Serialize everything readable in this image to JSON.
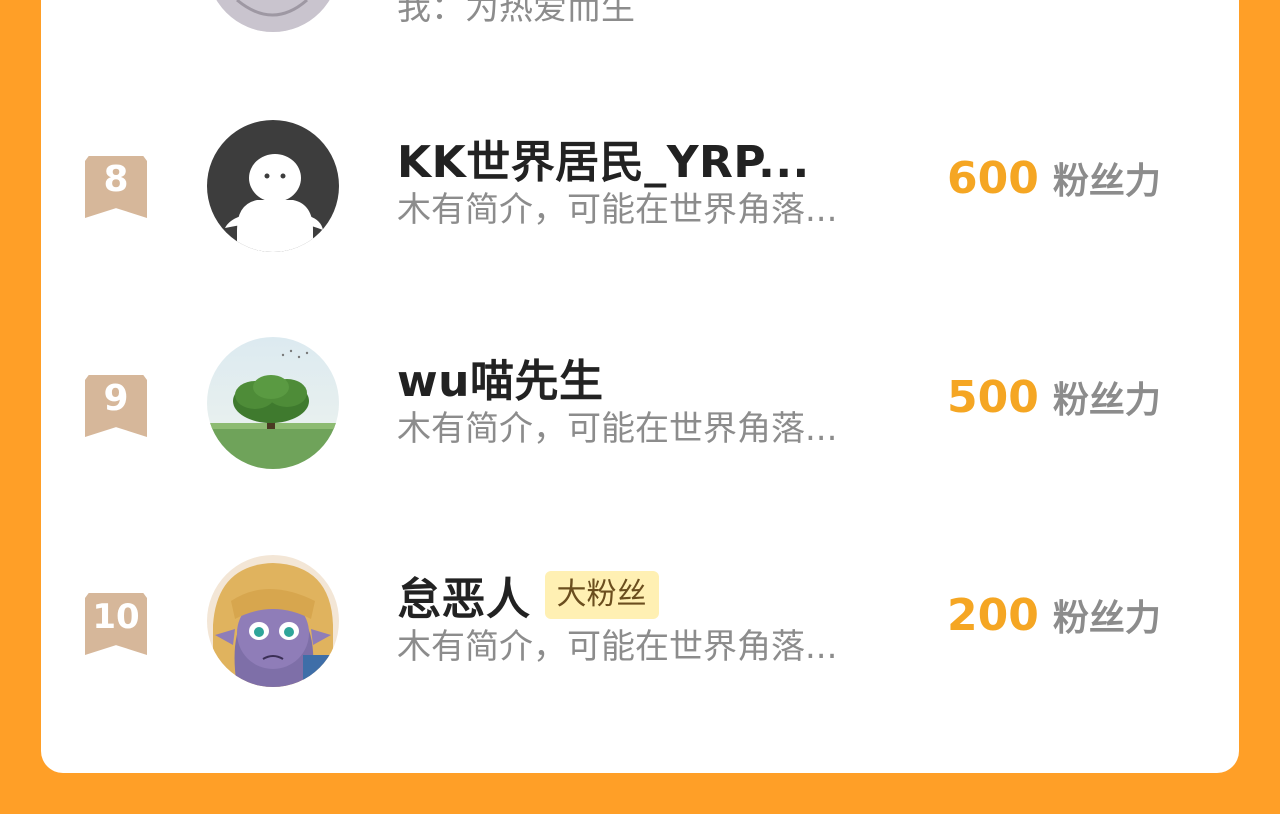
{
  "prev_entry": {
    "desc": "我：为热爱而生"
  },
  "ranking": [
    {
      "rank": "8",
      "name": "KK世界居民_YRP...",
      "tag": "",
      "desc": "木有简介，可能在世界角落...",
      "power_value": "600",
      "power_unit": "粉丝力",
      "avatar_icon": "ghost-silhouette-icon"
    },
    {
      "rank": "9",
      "name": "wu喵先生",
      "tag": "",
      "desc": "木有简介，可能在世界角落...",
      "power_value": "500",
      "power_unit": "粉丝力",
      "avatar_icon": "tree-landscape-photo"
    },
    {
      "rank": "10",
      "name": "怠恶人",
      "tag": "大粉丝",
      "desc": "木有简介，可能在世界角落...",
      "power_value": "200",
      "power_unit": "粉丝力",
      "avatar_icon": "anime-elf-girl-avatar"
    }
  ],
  "colors": {
    "background": "#FF9F27",
    "card": "#FFFFFF",
    "rank_badge": "#D6B79A",
    "power_number": "#F5A623",
    "tag_bg": "#FFF0B3"
  }
}
